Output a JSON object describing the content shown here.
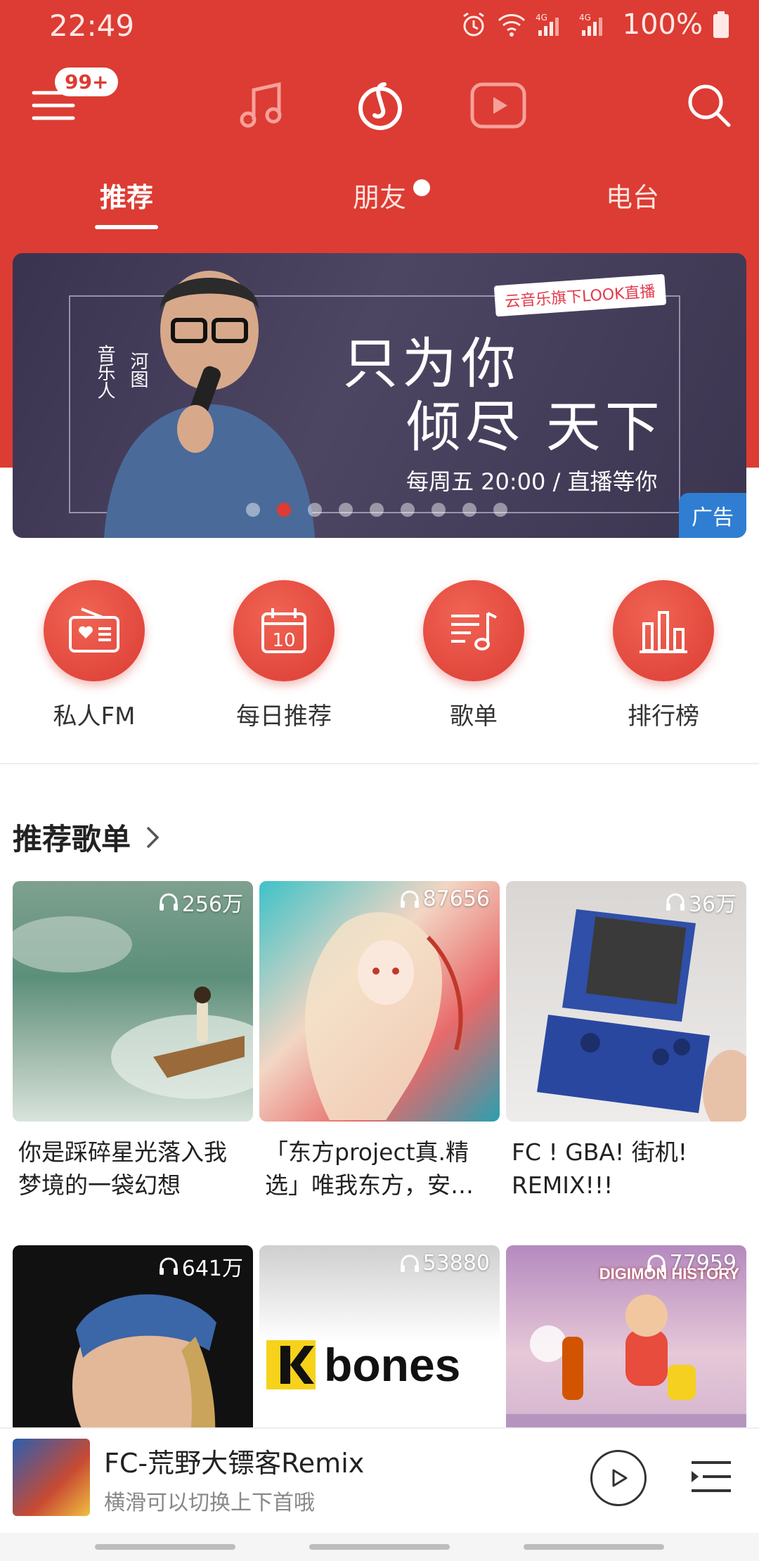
{
  "status_bar": {
    "time": "22:49",
    "battery": "100%",
    "network": "4G"
  },
  "top_nav": {
    "badge": "99+",
    "icons": [
      "menu-icon",
      "music-note-icon",
      "netease-logo-icon",
      "video-icon",
      "search-icon"
    ]
  },
  "tabs": [
    {
      "label": "推荐",
      "active": true
    },
    {
      "label": "朋友",
      "active": false,
      "dot": true
    },
    {
      "label": "电台",
      "active": false
    }
  ],
  "banner": {
    "live_tag": "云音乐旗下LOOK直播",
    "headline_line1": "只为你",
    "headline_line2": "倾尽 天下",
    "schedule": "每周五 20:00 / 直播等你",
    "role": "音乐人",
    "artist": "河图",
    "ad_label": "广告",
    "page_count": 9,
    "active_page": 2
  },
  "quick_entries": [
    {
      "label": "私人FM",
      "icon": "radio-heart-icon"
    },
    {
      "label": "每日推荐",
      "icon": "calendar-icon",
      "day": "10"
    },
    {
      "label": "歌单",
      "icon": "playlist-icon"
    },
    {
      "label": "排行榜",
      "icon": "bar-chart-icon"
    }
  ],
  "section": {
    "title": "推荐歌单"
  },
  "playlists": [
    {
      "plays": "256万",
      "title": "你是踩碎星光落入我梦境的一袋幻想"
    },
    {
      "plays": "87656",
      "title": "「东方project真.精选」唯我东方，安…"
    },
    {
      "plays": "36万",
      "title": "FC ! GBA! 街机! REMIX!!!"
    },
    {
      "plays": "641万",
      "title": ""
    },
    {
      "plays": "53880",
      "title": "",
      "cover_text": "bones"
    },
    {
      "plays": "77959",
      "title": "",
      "cover_text": "DIGIMON HISTORY"
    }
  ],
  "player": {
    "title": "FC-荒野大镖客Remix",
    "subtitle": "横滑可以切换上下首哦"
  },
  "colors": {
    "accent": "#dc3c33",
    "ad_blue": "#2f7ed2"
  }
}
